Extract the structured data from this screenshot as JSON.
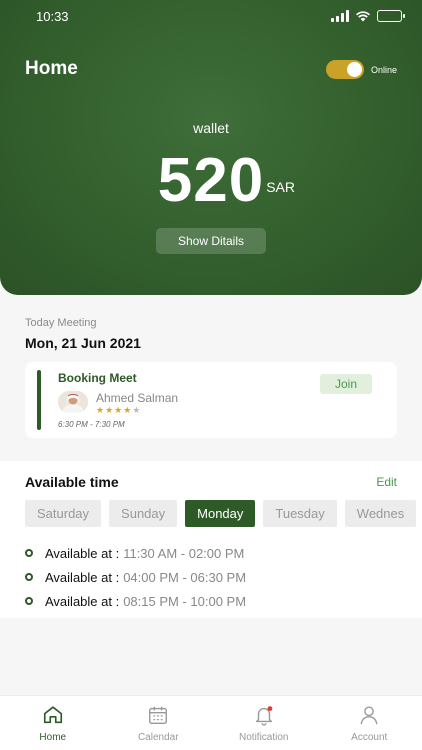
{
  "status_bar": {
    "time": "10:33"
  },
  "header": {
    "title": "Home",
    "toggle_label": "Online",
    "toggle_on": true
  },
  "wallet": {
    "label": "wallet",
    "amount": "520",
    "currency": "SAR",
    "button_label": "Show Ditails"
  },
  "meeting": {
    "section_label": "Today Meeting",
    "date": "Mon, 21 Jun 2021",
    "title": "Booking Meet",
    "person": "Ahmed Salman",
    "rating": 4,
    "rating_max": 5,
    "time": "6:30 PM - 7:30 PM",
    "join_label": "Join"
  },
  "availability": {
    "title": "Available time",
    "edit_label": "Edit",
    "days": [
      "Saturday",
      "Sunday",
      "Monday",
      "Tuesday",
      "Wednes"
    ],
    "active_day": "Monday",
    "slots": [
      {
        "label": "Available at :",
        "time": "11:30 AM - 02:00 PM"
      },
      {
        "label": "Available at :",
        "time": "04:00 PM - 06:30 PM"
      },
      {
        "label": "Available at :",
        "time": "08:15 PM - 10:00 PM"
      }
    ]
  },
  "tabbar": {
    "items": [
      {
        "label": "Home",
        "icon": "home-icon",
        "active": true
      },
      {
        "label": "Calendar",
        "icon": "calendar-icon",
        "active": false
      },
      {
        "label": "Notification",
        "icon": "bell-icon",
        "active": false
      },
      {
        "label": "Account",
        "icon": "user-icon",
        "active": false
      }
    ]
  },
  "colors": {
    "primary": "#2d5a27",
    "accent": "#c9a227",
    "join_text": "#4a9a4a",
    "star": "#d4a92a",
    "notification_dot": "#e53935"
  }
}
